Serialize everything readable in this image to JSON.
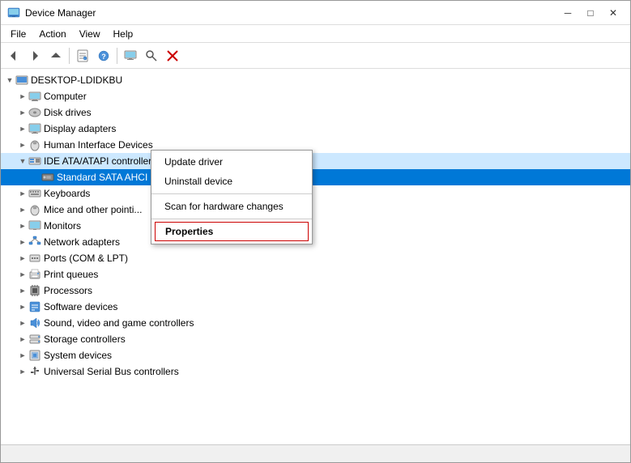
{
  "window": {
    "title": "Device Manager",
    "title_icon": "🖥",
    "buttons": {
      "minimize": "─",
      "maximize": "□",
      "close": "✕"
    }
  },
  "menu": {
    "items": [
      "File",
      "Action",
      "View",
      "Help"
    ]
  },
  "toolbar": {
    "buttons": [
      {
        "name": "back",
        "icon": "◄"
      },
      {
        "name": "forward",
        "icon": "►"
      },
      {
        "name": "up",
        "icon": "▲"
      },
      {
        "name": "properties",
        "icon": "📋"
      },
      {
        "name": "help",
        "icon": "?"
      },
      {
        "name": "monitor",
        "icon": "🖥"
      },
      {
        "name": "scan",
        "icon": "🔍"
      },
      {
        "name": "remove",
        "icon": "✕"
      }
    ]
  },
  "tree": {
    "root": {
      "label": "DESKTOP-LDIDKBU",
      "expanded": true,
      "icon": "💻"
    },
    "items": [
      {
        "label": "Computer",
        "indent": 1,
        "icon": "💻",
        "expanded": false,
        "hasChildren": true
      },
      {
        "label": "Disk drives",
        "indent": 1,
        "icon": "💿",
        "expanded": false,
        "hasChildren": true
      },
      {
        "label": "Display adapters",
        "indent": 1,
        "icon": "🖥",
        "expanded": false,
        "hasChildren": true
      },
      {
        "label": "Human Interface Devices",
        "indent": 1,
        "icon": "🖱",
        "expanded": false,
        "hasChildren": true
      },
      {
        "label": "IDE ATA/ATAPI controllers",
        "indent": 1,
        "icon": "🔧",
        "expanded": true,
        "hasChildren": true
      },
      {
        "label": "Standard SATA AHCI Controller",
        "indent": 2,
        "icon": "⚙",
        "expanded": false,
        "hasChildren": false,
        "selected": true
      },
      {
        "label": "Keyboards",
        "indent": 1,
        "icon": "⌨",
        "expanded": false,
        "hasChildren": true
      },
      {
        "label": "Mice and other pointi...",
        "indent": 1,
        "icon": "🖱",
        "expanded": false,
        "hasChildren": true
      },
      {
        "label": "Monitors",
        "indent": 1,
        "icon": "🖥",
        "expanded": false,
        "hasChildren": true
      },
      {
        "label": "Network adapters",
        "indent": 1,
        "icon": "🌐",
        "expanded": false,
        "hasChildren": true
      },
      {
        "label": "Ports (COM & LPT)",
        "indent": 1,
        "icon": "🔌",
        "expanded": false,
        "hasChildren": true
      },
      {
        "label": "Print queues",
        "indent": 1,
        "icon": "🖨",
        "expanded": false,
        "hasChildren": true
      },
      {
        "label": "Processors",
        "indent": 1,
        "icon": "💻",
        "expanded": false,
        "hasChildren": true
      },
      {
        "label": "Software devices",
        "indent": 1,
        "icon": "📦",
        "expanded": false,
        "hasChildren": true
      },
      {
        "label": "Sound, video and game controllers",
        "indent": 1,
        "icon": "🔊",
        "expanded": false,
        "hasChildren": true
      },
      {
        "label": "Storage controllers",
        "indent": 1,
        "icon": "💾",
        "expanded": false,
        "hasChildren": true
      },
      {
        "label": "System devices",
        "indent": 1,
        "icon": "⚙",
        "expanded": false,
        "hasChildren": true
      },
      {
        "label": "Universal Serial Bus controllers",
        "indent": 1,
        "icon": "🔌",
        "expanded": false,
        "hasChildren": true
      }
    ]
  },
  "contextMenu": {
    "items": [
      {
        "label": "Update driver",
        "type": "normal"
      },
      {
        "label": "Uninstall device",
        "type": "normal"
      },
      {
        "label": "sep1",
        "type": "separator"
      },
      {
        "label": "Scan for hardware changes",
        "type": "normal"
      },
      {
        "label": "sep2",
        "type": "separator"
      },
      {
        "label": "Properties",
        "type": "highlighted"
      }
    ]
  },
  "statusBar": {
    "text": ""
  }
}
